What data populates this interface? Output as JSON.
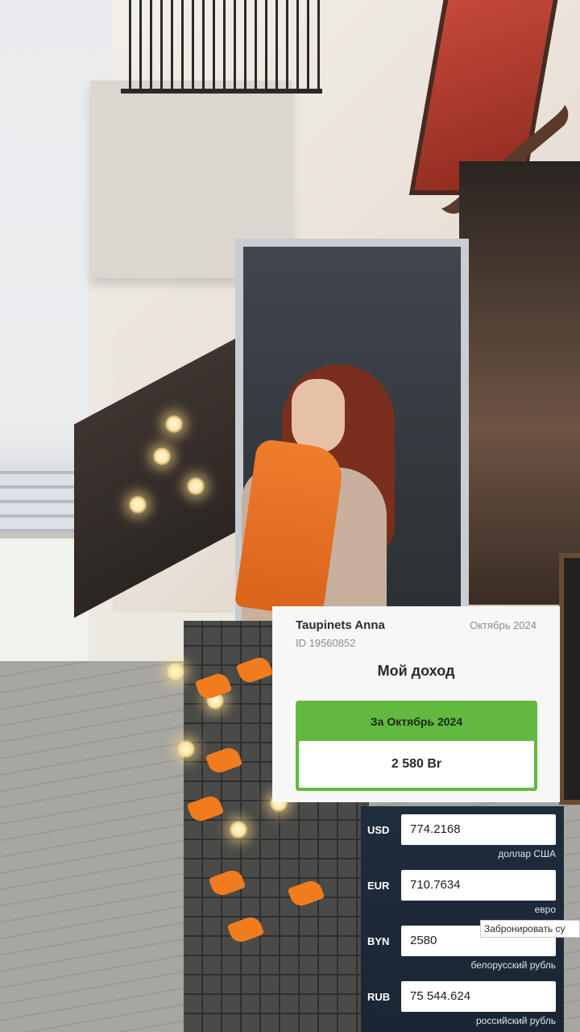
{
  "income_card": {
    "name": "Taupinets Anna",
    "period": "Октябрь 2024",
    "id": "ID 19560852",
    "title": "Мой доход",
    "period_label": "За Октябрь 2024",
    "amount": "2 580 Br",
    "accent_color": "#63b840"
  },
  "converter": {
    "rows": [
      {
        "code": "USD",
        "value": "774.2168",
        "name": "доллар США"
      },
      {
        "code": "EUR",
        "value": "710.7634",
        "name": "евро"
      },
      {
        "code": "BYN",
        "value": "2580",
        "name": "белорусский рубль"
      },
      {
        "code": "RUB",
        "value": "75 544.624",
        "name": "российский рубль"
      }
    ],
    "tooltip": "Забронировать су"
  }
}
